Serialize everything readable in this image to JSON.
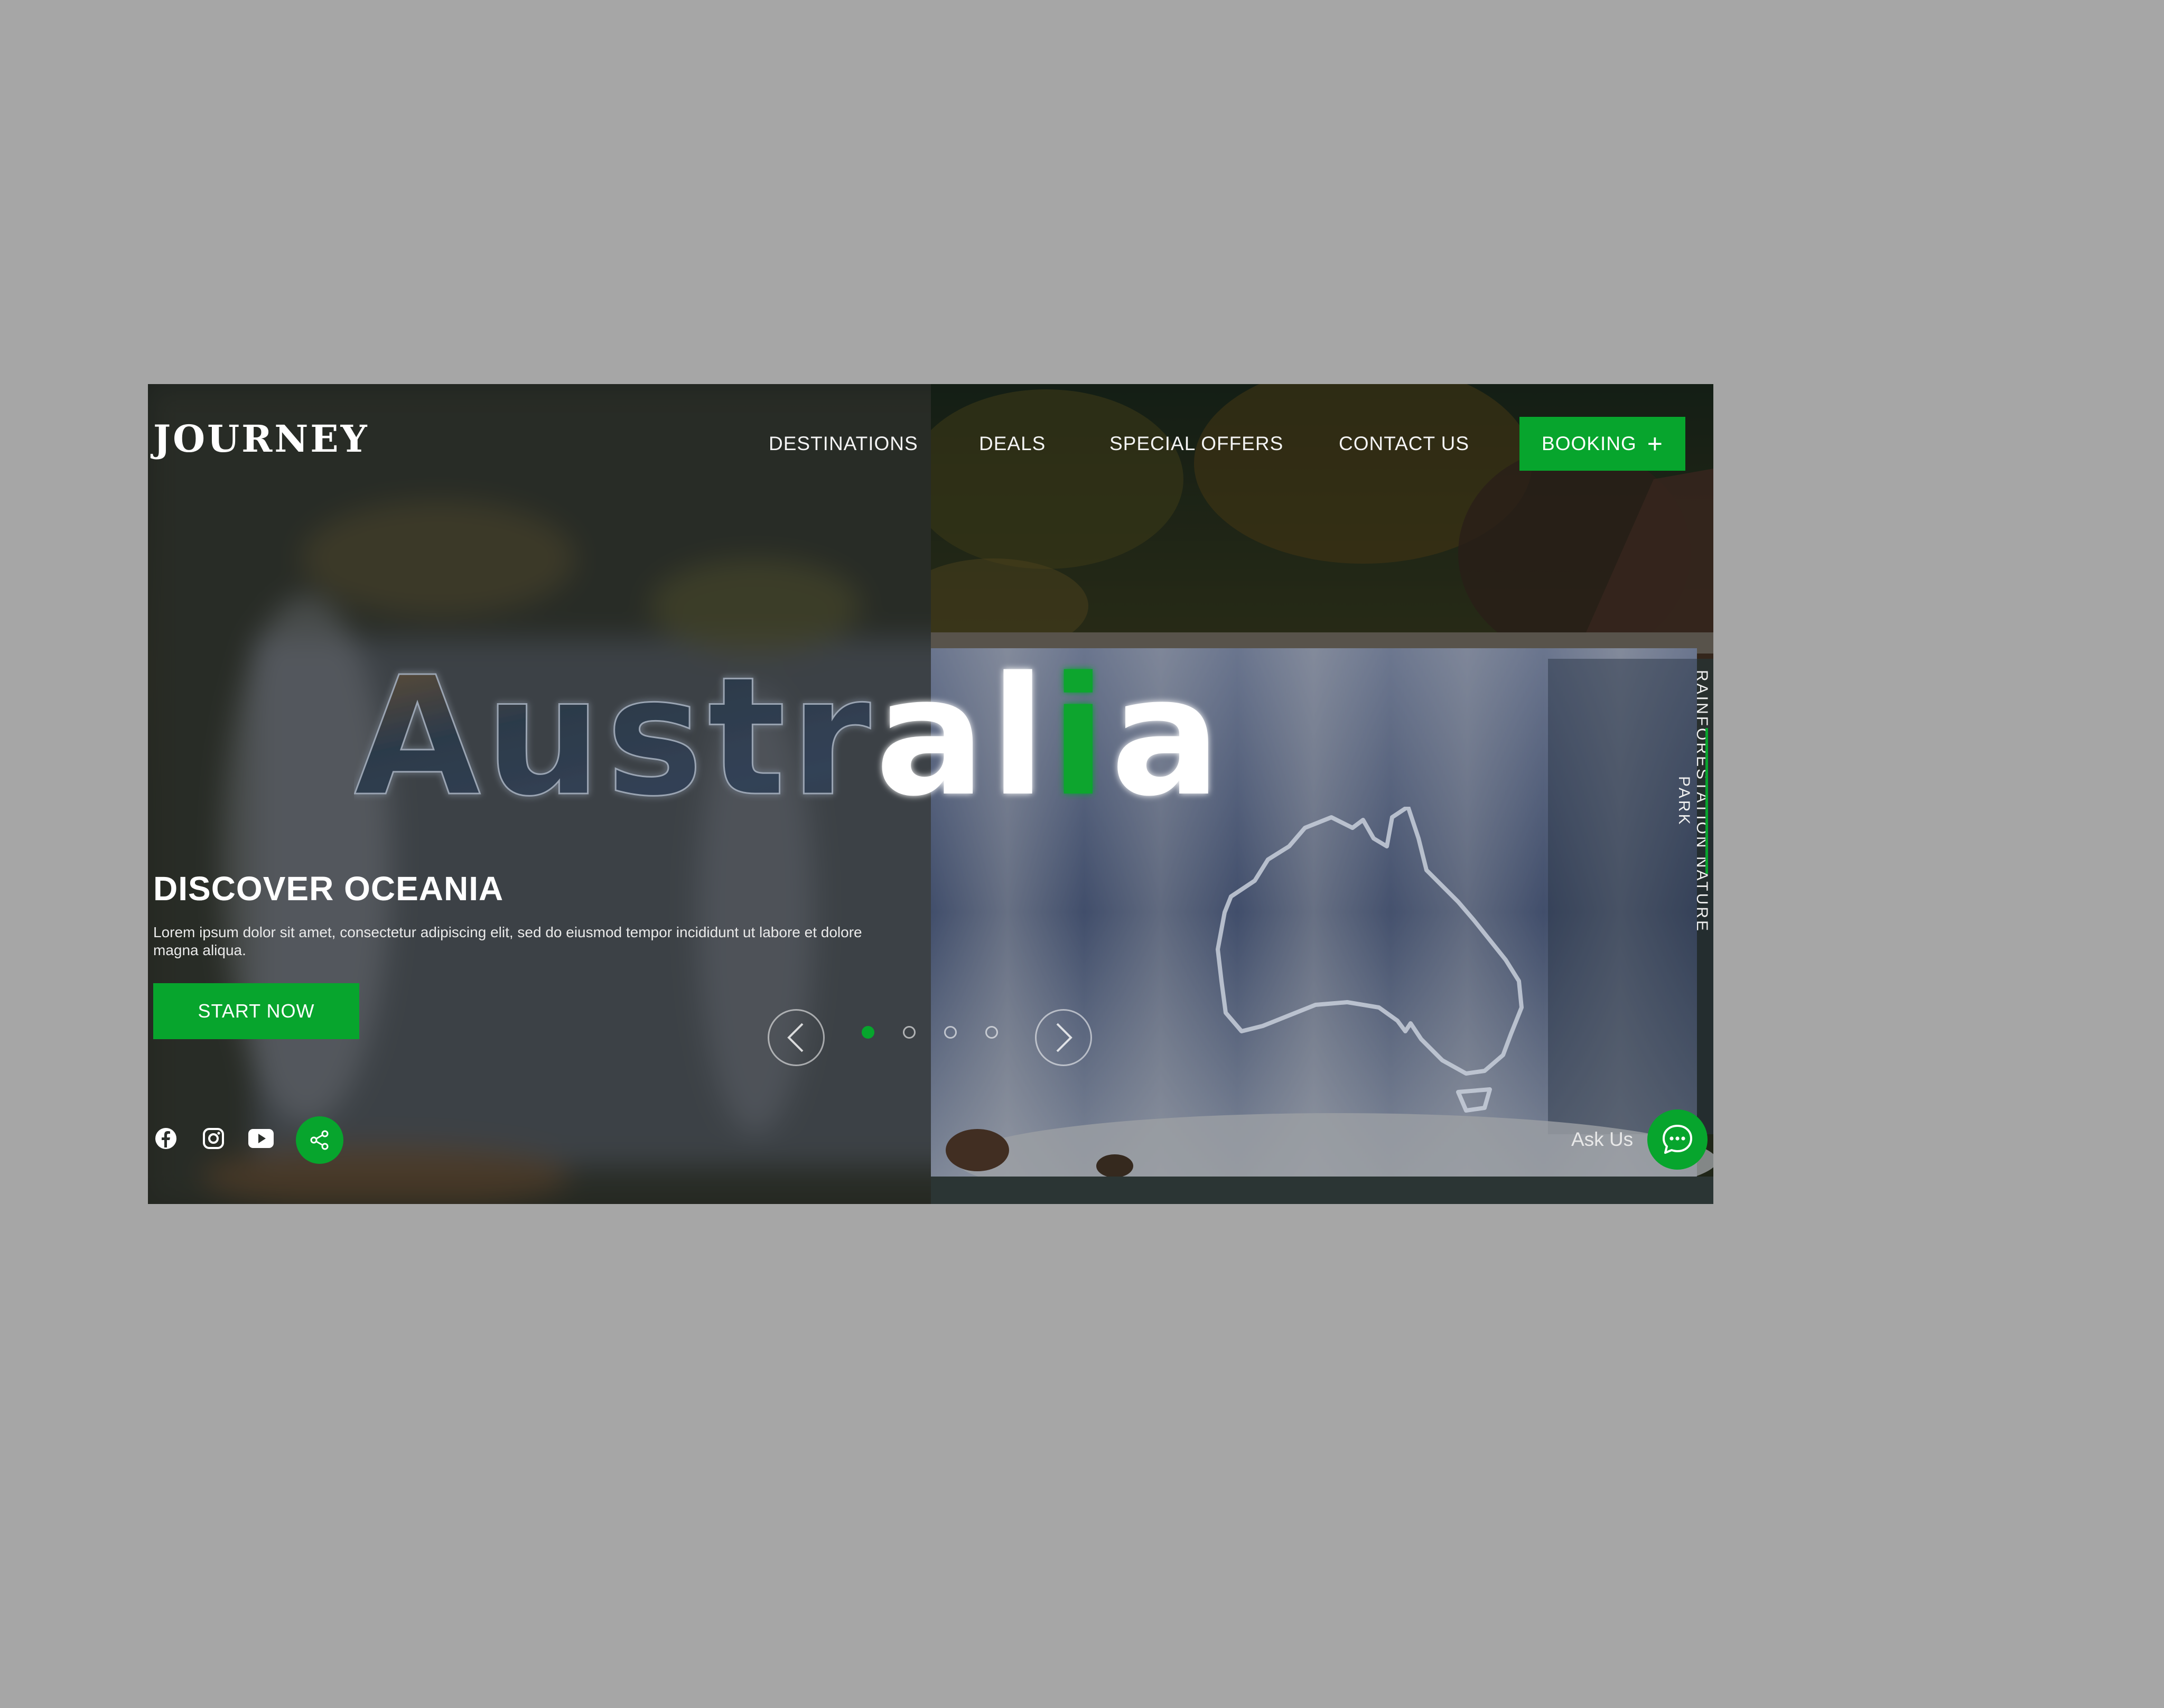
{
  "brand": {
    "logo": "JOURNEY"
  },
  "nav": {
    "items": [
      {
        "label": "DESTINATIONS"
      },
      {
        "label": "DEALS"
      },
      {
        "label": "SPECIAL OFFERS"
      },
      {
        "label": "CONTACT US"
      }
    ],
    "booking_label": "BOOKING",
    "booking_icon": "plus-icon"
  },
  "hero": {
    "big_word": "Australia",
    "big_word_parts": {
      "image_filled": "Austr",
      "white": "al",
      "accent": "i",
      "white_end": "a"
    },
    "side_caption": "RAINFORESTATION NATURE PARK",
    "heading": "DISCOVER OCEANIA",
    "description": "Lorem ipsum dolor sit amet, consectetur adipiscing elit, sed do eiusmod tempor incididunt ut labore et dolore magna aliqua.",
    "cta_label": "START NOW"
  },
  "carousel": {
    "prev_icon": "chevron-left-icon",
    "next_icon": "chevron-right-icon",
    "slide_count": 4,
    "active_slide": 1
  },
  "social": {
    "icons": [
      "facebook-icon",
      "instagram-icon",
      "youtube-icon",
      "share-icon"
    ]
  },
  "chat": {
    "label": "Ask Us",
    "icon": "chat-icon"
  },
  "colors": {
    "accent": "#07a52d",
    "page_background": "#a6a6a6",
    "text_light": "#ffffff"
  }
}
